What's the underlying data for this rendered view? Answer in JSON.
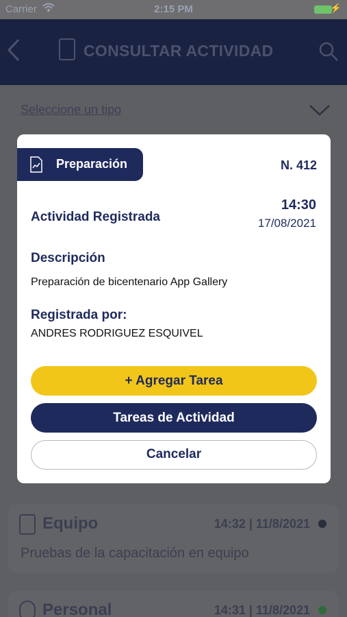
{
  "status_bar": {
    "carrier": "Carrier",
    "time": "2:15 PM"
  },
  "navbar": {
    "title": "CONSULTAR ACTIVIDAD",
    "icons": [
      "chevron-left-icon",
      "document-icon",
      "search-icon"
    ]
  },
  "filter": {
    "placeholder": "Seleccione un tipo"
  },
  "modal": {
    "type_label": "Preparación",
    "number": "N. 412",
    "status_label": "Actividad Registrada",
    "time": "14:30",
    "date": "17/08/2021",
    "description_title": "Descripción",
    "description_text": "Preparación de bicentenario App Gallery",
    "registered_by_title": "Registrada por:",
    "registered_by_name": "ANDRES RODRIGUEZ ESQUIVEL",
    "buttons": {
      "add_task": "+ Agregar Tarea",
      "activity_tasks": "Tareas de Actividad",
      "cancel": "Cancelar"
    }
  },
  "list": [
    {
      "title": "Equipo",
      "meta": "14:32 | 11/8/2021",
      "description": "Pruebas de la capacitación en equipo",
      "dot_color": "#2a2d3a"
    },
    {
      "title": "Personal",
      "meta": "14:31 | 11/8/2021",
      "dot_color": "#2f6b3a"
    }
  ],
  "colors": {
    "navy": "#1f2a5c",
    "yellow": "#f2c618",
    "overlay": "#5e5f63"
  }
}
